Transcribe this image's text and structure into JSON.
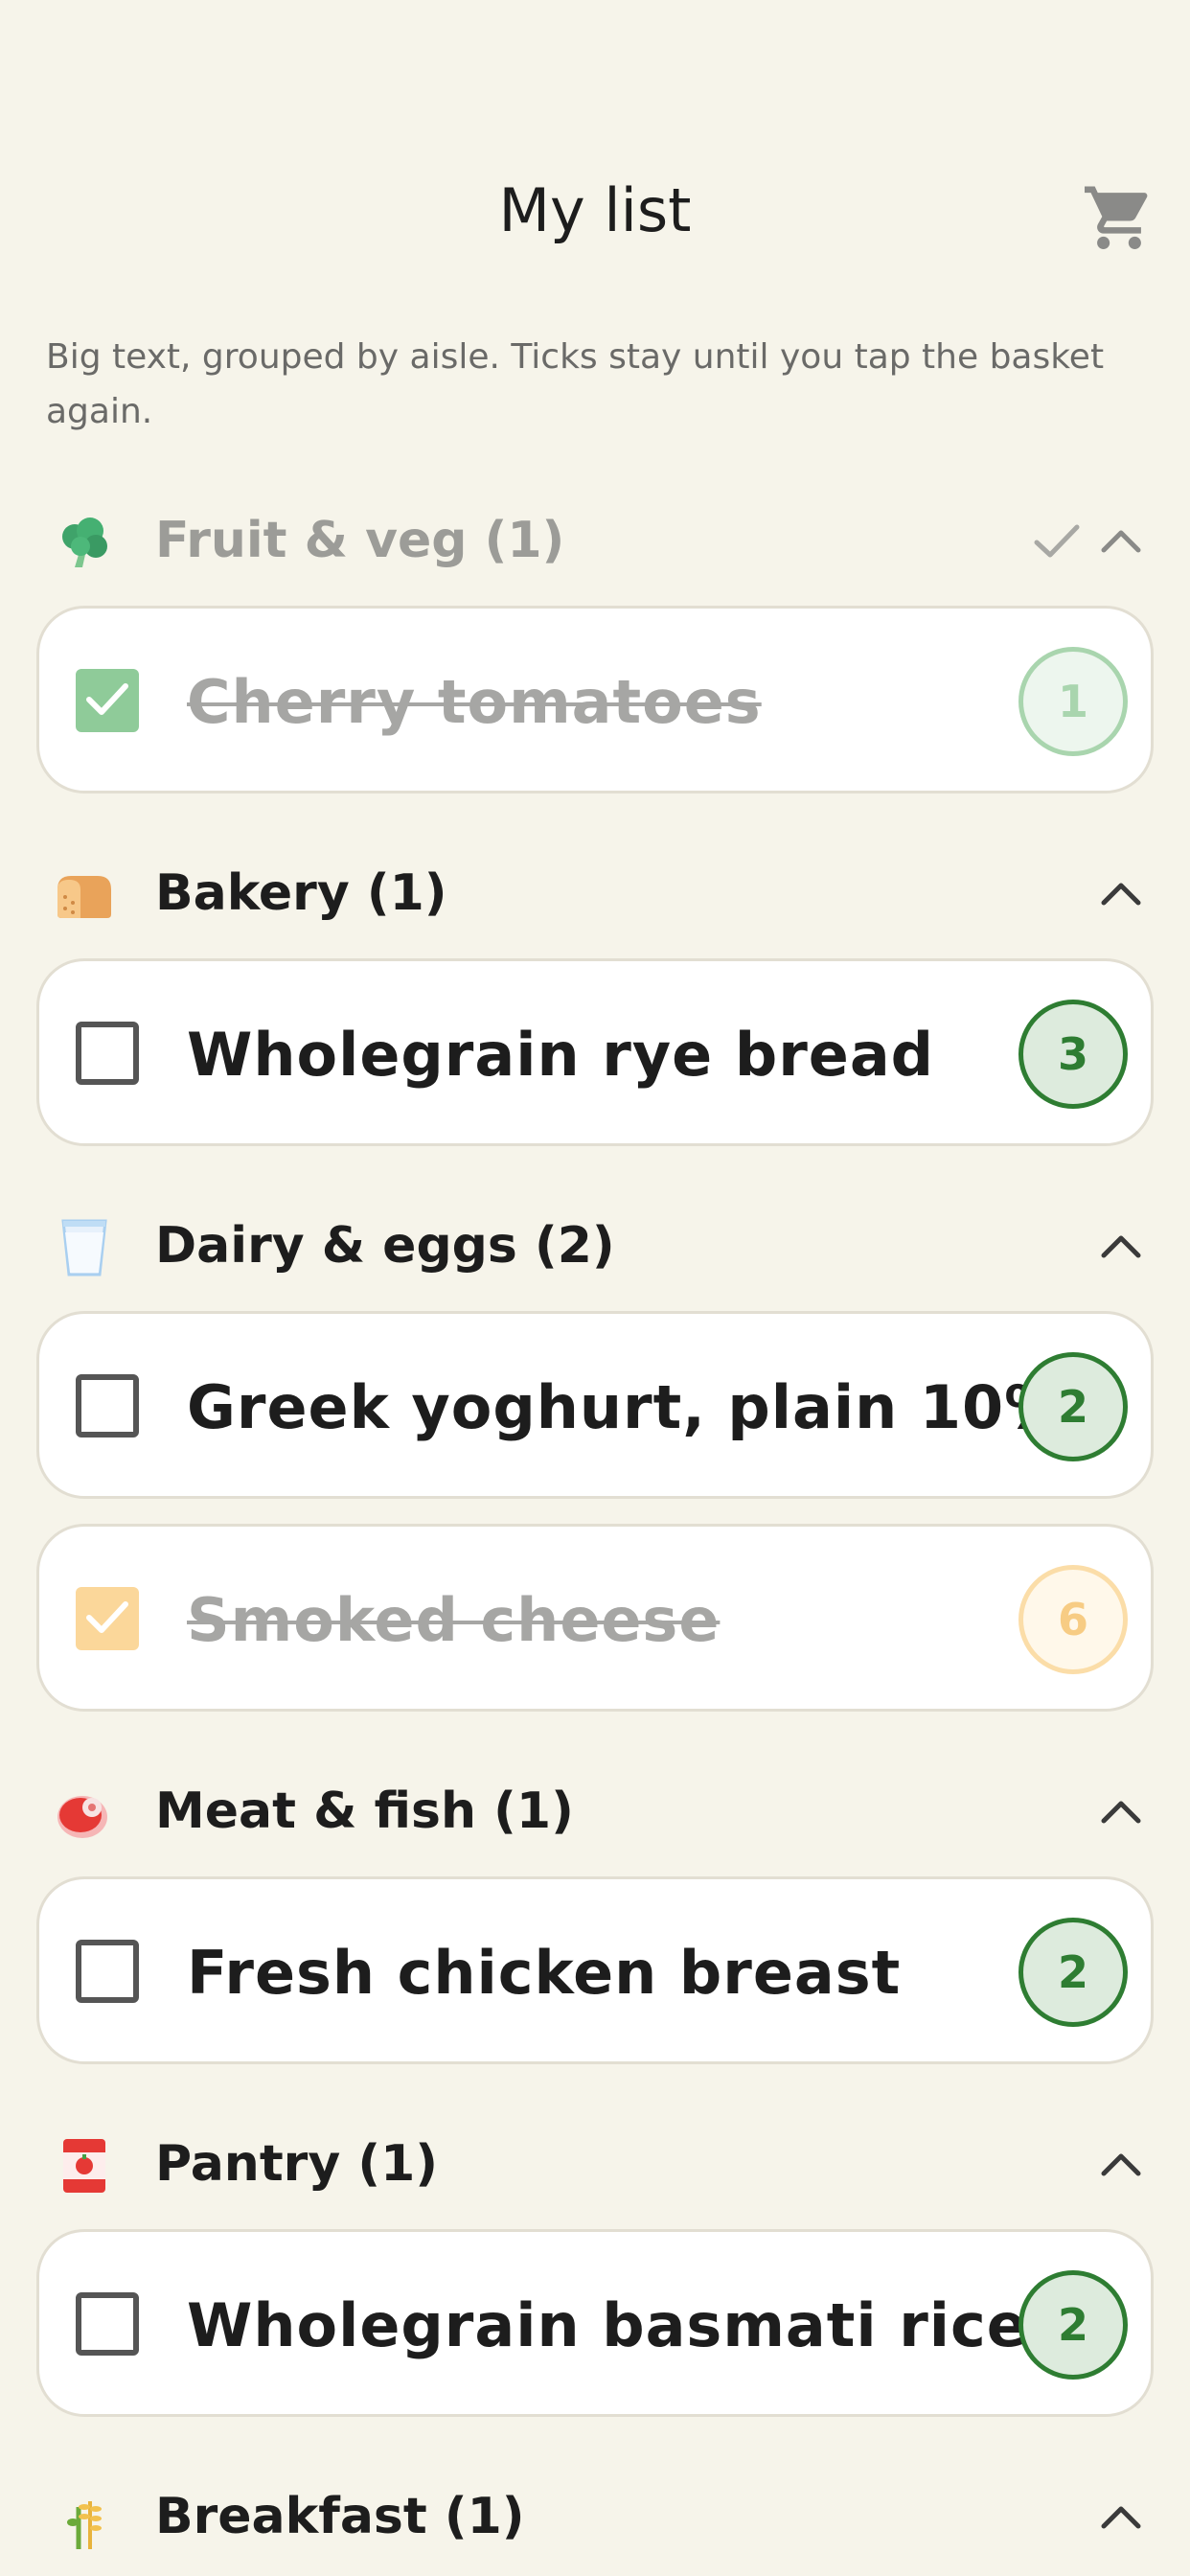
{
  "header": {
    "title": "My list",
    "cart_icon": "shopping-cart-icon"
  },
  "subtitle": "Big text, grouped by aisle. Ticks stay until you tap the basket again.",
  "colors": {
    "accent_green": "#2E7D32",
    "qty_bg": "#DDEBDD",
    "background": "#F6F4EA",
    "checked_green": "#8FCB99",
    "checked_orange": "#FBD79A"
  },
  "sections": [
    {
      "title": "Fruit & veg (1)",
      "icon": "broccoli-icon",
      "done": true,
      "items": [
        {
          "name": "Cherry tomatoes",
          "qty": "1",
          "checked": true,
          "check_color": "#8FCB99",
          "qty_color": "#A9D5AE"
        }
      ]
    },
    {
      "title": "Bakery (1)",
      "icon": "bread-icon",
      "done": false,
      "items": [
        {
          "name": "Wholegrain rye bread",
          "qty": "3",
          "checked": false
        }
      ]
    },
    {
      "title": "Dairy & eggs (2)",
      "icon": "milk-glass-icon",
      "done": false,
      "items": [
        {
          "name": "Greek yoghurt, plain 10%",
          "qty": "2",
          "checked": false
        },
        {
          "name": "Smoked cheese",
          "qty": "6",
          "checked": true,
          "check_color": "#FBD79A",
          "qty_color": "#FBDDA8"
        }
      ]
    },
    {
      "title": "Meat & fish (1)",
      "icon": "meat-icon",
      "done": false,
      "items": [
        {
          "name": "Fresh chicken breast",
          "qty": "2",
          "checked": false
        }
      ]
    },
    {
      "title": "Pantry (1)",
      "icon": "canned-food-icon",
      "done": false,
      "items": [
        {
          "name": "Wholegrain basmati rice",
          "qty": "2",
          "checked": false
        }
      ]
    },
    {
      "title": "Breakfast (1)",
      "icon": "wheat-icon",
      "done": false,
      "items": []
    }
  ]
}
